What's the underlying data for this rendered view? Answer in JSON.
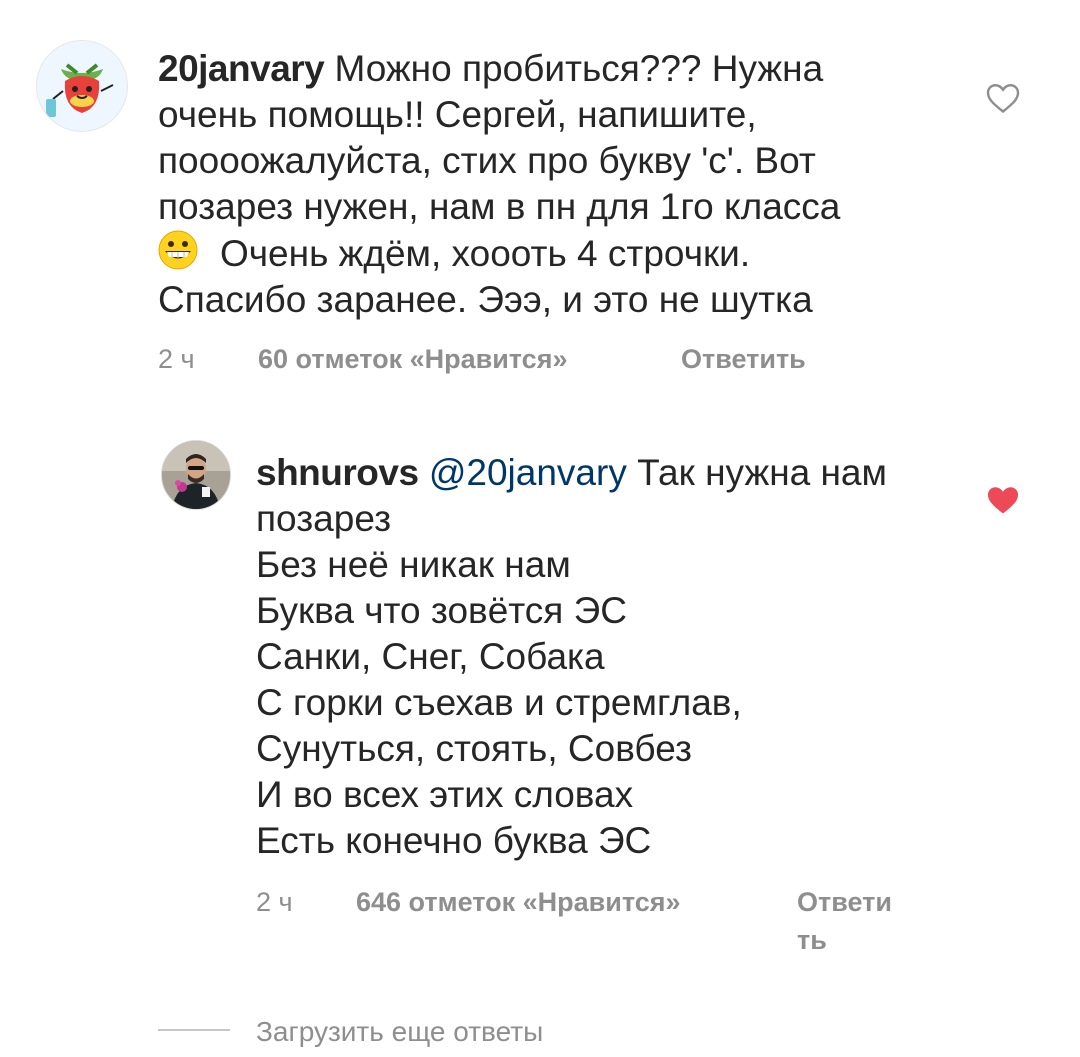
{
  "comment": {
    "username": "20janvary",
    "text_line1": "Можно пробиться??? Нужна",
    "text_line2": "очень помощь!! Сергей, напишите,",
    "text_line3": "поооожалуйста, стих про букву 'с'. Вот",
    "text_line4": "позарез нужен,  нам в пн для 1го класса",
    "emoji": "grinning-face-emoji",
    "text_line5": "Очень ждём, хоооть 4 строчки.",
    "text_line6": "Спасибо заранее. Эээ, и это не шутка",
    "time": "2 ч",
    "likes": "60 отметок «Нравится»",
    "reply": "Ответить",
    "liked": false,
    "avatar_icon": "strawberry-avatar-icon"
  },
  "reply_comment": {
    "username": "shnurovs",
    "mention": "@20janvary",
    "text_line1": "Так нужна нам",
    "text_line2": "позарез",
    "text_line3": "Без неё никак нам",
    "text_line4": "Буква что зовётся ЭС",
    "text_line5": "Санки, Снег, Собака",
    "text_line6": "С горки съехав и стремглав,",
    "text_line7": "Сунуться, стоять, Совбез",
    "text_line8": "И во всех этих словах",
    "text_line9": "Есть конечно буква ЭС",
    "time": "2 ч",
    "likes": "646 отметок «Нравится»",
    "reply": "Ответить",
    "liked": true,
    "avatar_icon": "man-with-flowers-avatar-icon"
  },
  "load_more": {
    "label": "Загрузить еще ответы"
  },
  "colors": {
    "text": "#262626",
    "secondary": "#8e8e8e",
    "mention": "#00376b",
    "heart_active": "#ed4956",
    "heart_outline": "#8e8e8e"
  }
}
